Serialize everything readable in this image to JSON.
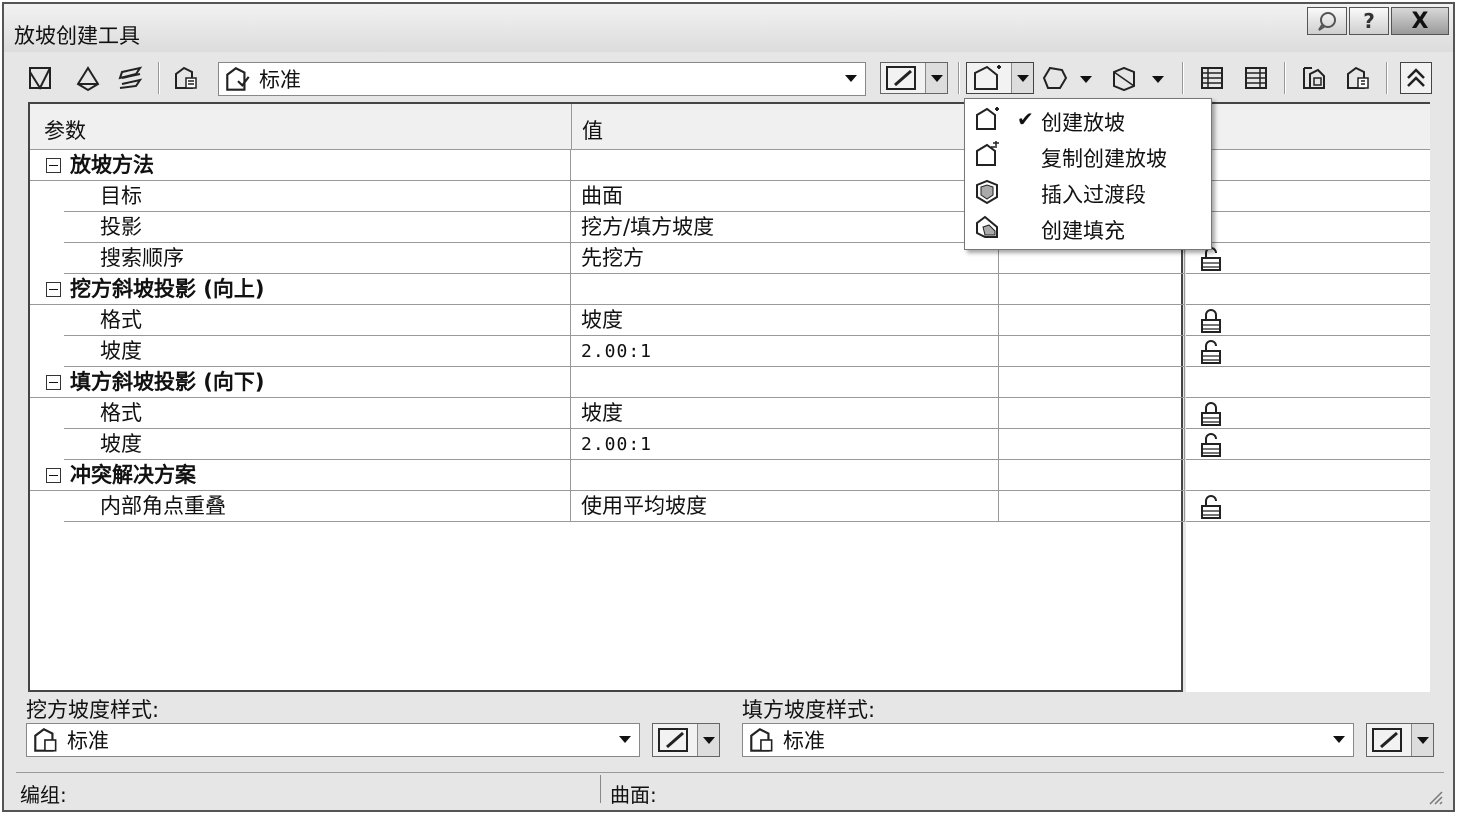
{
  "window": {
    "title": "放坡创建工具",
    "controls": {
      "help": "?",
      "close": "X"
    }
  },
  "toolbar": {
    "style_combo_value": "标准"
  },
  "grid": {
    "header": {
      "param": "参数",
      "value": "值"
    },
    "groups": [
      {
        "label": "放坡方法",
        "rows": [
          {
            "param": "目标",
            "value": "曲面",
            "lock": "none"
          },
          {
            "param": "投影",
            "value": "挖方/填方坡度",
            "lock": "none"
          },
          {
            "param": "搜索顺序",
            "value": "先挖方",
            "lock": "unlocked"
          }
        ]
      },
      {
        "label": "挖方斜坡投影 (向上)",
        "rows": [
          {
            "param": "格式",
            "value": "坡度",
            "lock": "locked"
          },
          {
            "param": "坡度",
            "value": "2.00:1",
            "lock": "unlocked"
          }
        ]
      },
      {
        "label": "填方斜坡投影 (向下)",
        "rows": [
          {
            "param": "格式",
            "value": "坡度",
            "lock": "locked"
          },
          {
            "param": "坡度",
            "value": "2.00:1",
            "lock": "unlocked"
          }
        ]
      },
      {
        "label": "冲突解决方案",
        "rows": [
          {
            "param": "内部角点重叠",
            "value": "使用平均坡度",
            "lock": "unlocked"
          }
        ]
      }
    ]
  },
  "dropdown_menu": {
    "items": [
      {
        "label": "创建放坡",
        "checked": true,
        "icon": "create-grading-icon"
      },
      {
        "label": "复制创建放坡",
        "checked": false,
        "icon": "copy-grading-icon"
      },
      {
        "label": "插入过渡段",
        "checked": false,
        "icon": "transition-icon"
      },
      {
        "label": "创建填充",
        "checked": false,
        "icon": "infill-icon"
      }
    ]
  },
  "bottom": {
    "cut_label": "挖方坡度样式:",
    "cut_value": "标准",
    "fill_label": "填方坡度样式:",
    "fill_value": "标准"
  },
  "status": {
    "group_label": "编组:",
    "surface_label": "曲面:"
  }
}
